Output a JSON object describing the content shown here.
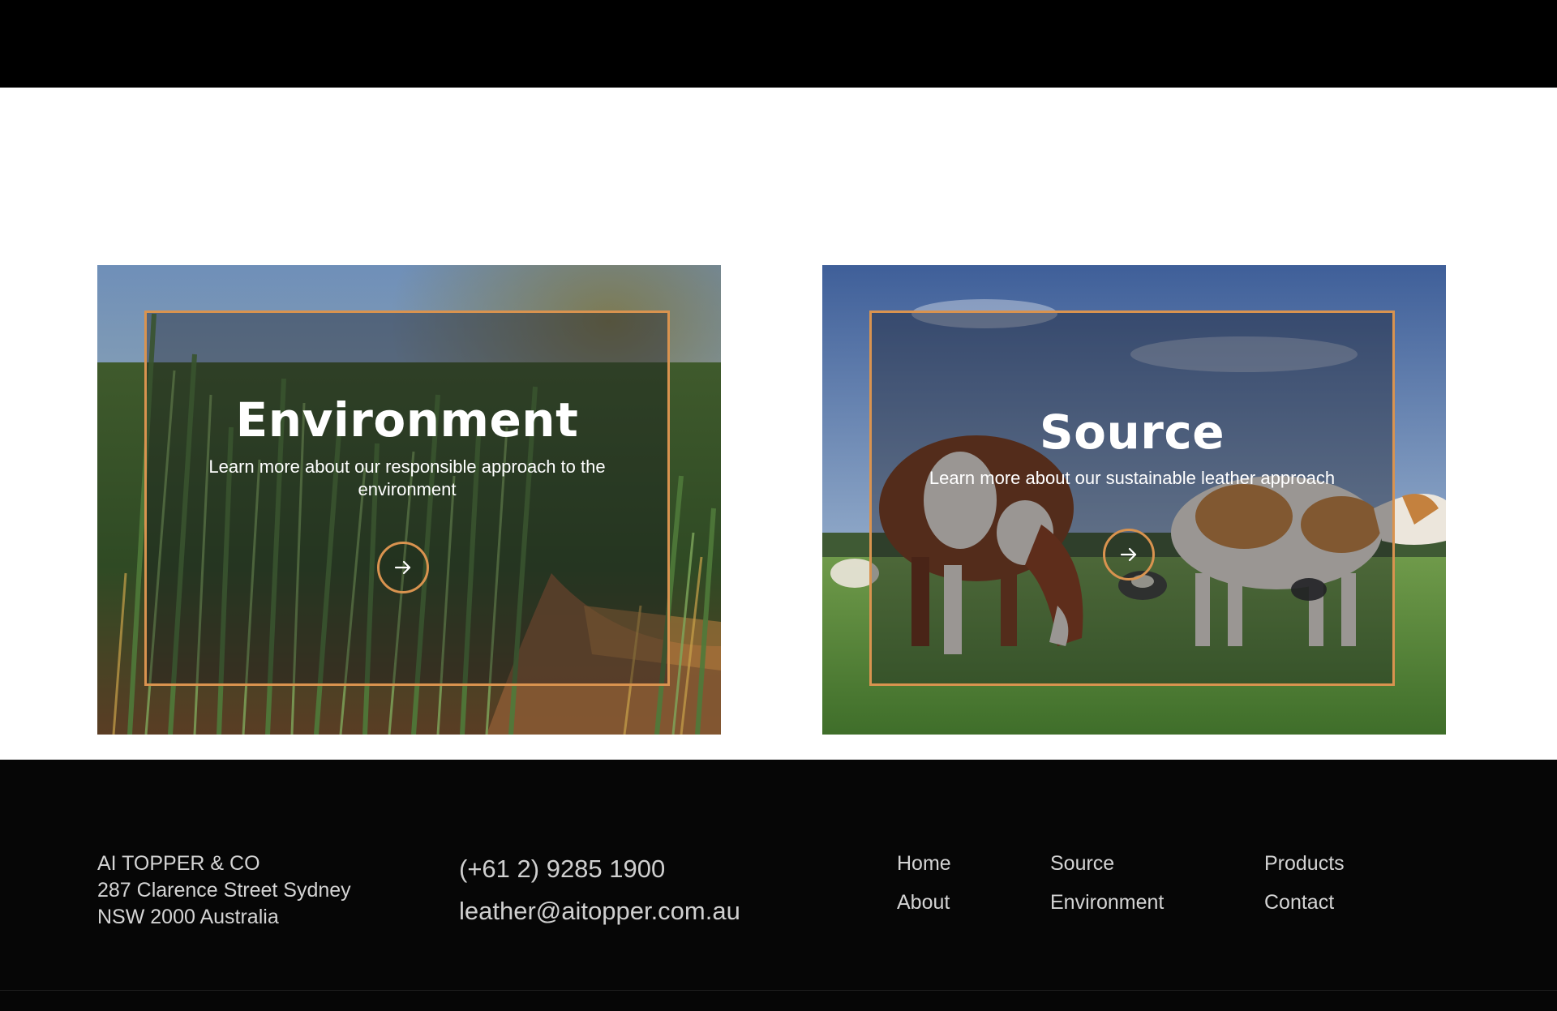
{
  "cards": [
    {
      "title": "Environment",
      "description": "Learn more about our responsible approach to the environment",
      "icon": "arrow-right-icon",
      "image": "wheat field close-up"
    },
    {
      "title": "Source",
      "description": "Learn more about our sustainable leather approach",
      "icon": "arrow-right-icon",
      "image": "cows grazing in pasture"
    }
  ],
  "footer": {
    "company": "AI TOPPER & CO",
    "address_line1": "287 Clarence Street Sydney",
    "address_line2": "NSW 2000 Australia",
    "phone": "(+61 2) 9285 1900",
    "email": "leather@aitopper.com.au",
    "nav": {
      "home": "Home",
      "about": "About",
      "source": "Source",
      "environment": "Environment",
      "products": "Products",
      "contact": "Contact"
    }
  },
  "colors": {
    "accent": "#d9934f",
    "header_bg": "#000000",
    "footer_bg": "#060606",
    "footer_text": "#d4d4d4"
  }
}
